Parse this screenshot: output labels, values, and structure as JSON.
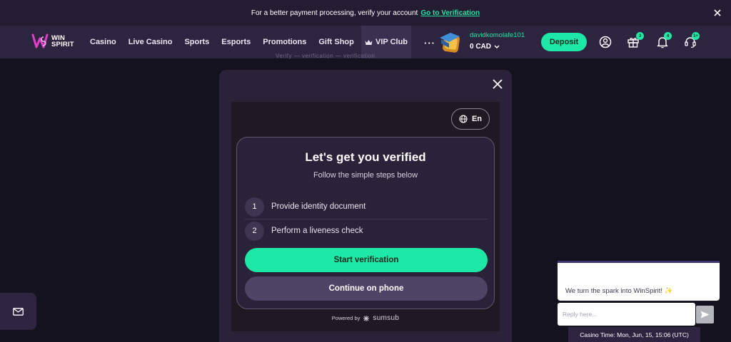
{
  "banner": {
    "text": "For a better payment processing, verify your account",
    "link": "Go to Verification"
  },
  "header": {
    "logo_line1": "WIN",
    "logo_line2": "SPIRIT",
    "nav": [
      "Casino",
      "Live Casino",
      "Sports",
      "Esports",
      "Promotions",
      "Gift Shop"
    ],
    "vip_label": "VIP Club",
    "more_label": "···",
    "username": "davidkomolafe101",
    "balance": "0 CAD",
    "deposit_label": "Deposit",
    "gift_badge": "3",
    "bell_badge": "4",
    "support_badge": "1+"
  },
  "ghost_steps": "Verify — verification — verification",
  "verification": {
    "language": "En",
    "title": "Let's get you verified",
    "subtitle": "Follow the simple steps below",
    "steps": [
      {
        "num": "1",
        "label": "Provide identity document"
      },
      {
        "num": "2",
        "label": "Perform a liveness check"
      }
    ],
    "start_label": "Start verification",
    "phone_label": "Continue on phone",
    "powered_by": "Powered by",
    "powered_brand": "sumsub"
  },
  "chat": {
    "message": "We turn the spark into WinSpirit! ✨",
    "reply_placeholder": "Reply here...",
    "casino_time": "Casino Time: Mon, Jun, 15, 15:06 (UTC)"
  },
  "colors": {
    "accent": "#1ee8a6",
    "header_bg": "#2d2540",
    "page_bg": "#15121f"
  }
}
